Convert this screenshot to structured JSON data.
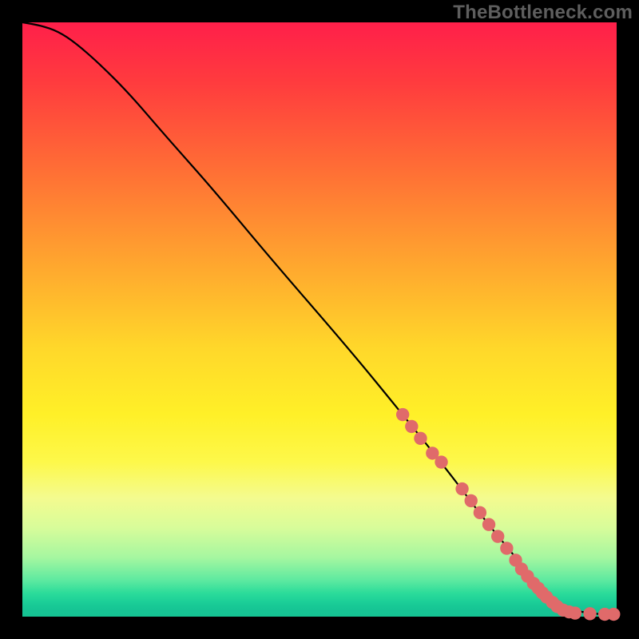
{
  "watermark": "TheBottleneck.com",
  "chart_data": {
    "type": "line",
    "title": "",
    "xlabel": "",
    "ylabel": "",
    "xlim": [
      0,
      100
    ],
    "ylim": [
      0,
      100
    ],
    "gradient_direction": "top-to-bottom",
    "gradient_stops": [
      {
        "pos": 0,
        "hex": "#ff1f4a"
      },
      {
        "pos": 10,
        "hex": "#ff3b3e"
      },
      {
        "pos": 25,
        "hex": "#ff6f35"
      },
      {
        "pos": 42,
        "hex": "#ffab2e"
      },
      {
        "pos": 55,
        "hex": "#ffd82a"
      },
      {
        "pos": 66,
        "hex": "#fff028"
      },
      {
        "pos": 74,
        "hex": "#fdf84a"
      },
      {
        "pos": 80,
        "hex": "#f4fb8f"
      },
      {
        "pos": 85,
        "hex": "#d8fc9a"
      },
      {
        "pos": 90,
        "hex": "#a6f7a0"
      },
      {
        "pos": 94,
        "hex": "#5be9a0"
      },
      {
        "pos": 96,
        "hex": "#2cdc9a"
      },
      {
        "pos": 97.5,
        "hex": "#1ccf98"
      },
      {
        "pos": 98.3,
        "hex": "#17c895"
      },
      {
        "pos": 99,
        "hex": "#16c494"
      },
      {
        "pos": 100,
        "hex": "#15c393"
      }
    ],
    "series": [
      {
        "name": "main-curve",
        "stroke": "#000000",
        "x": [
          0,
          3,
          6,
          9,
          13,
          18,
          24,
          32,
          42,
          55,
          64,
          72,
          78,
          83,
          86,
          88,
          90,
          92,
          94,
          96,
          98,
          100
        ],
        "y": [
          100,
          99.5,
          98.5,
          96.5,
          93,
          88,
          81,
          72,
          60,
          45,
          34,
          24,
          16,
          10,
          6,
          4,
          2.5,
          1.4,
          0.8,
          0.5,
          0.4,
          0.4
        ]
      }
    ],
    "markers": {
      "name": "highlight-dots",
      "color": "#e06a6a",
      "radius_pct": 1.1,
      "points": [
        {
          "x": 64,
          "y": 34
        },
        {
          "x": 65.5,
          "y": 32
        },
        {
          "x": 67,
          "y": 30
        },
        {
          "x": 69,
          "y": 27.5
        },
        {
          "x": 70.5,
          "y": 26
        },
        {
          "x": 74,
          "y": 21.5
        },
        {
          "x": 75.5,
          "y": 19.5
        },
        {
          "x": 77,
          "y": 17.5
        },
        {
          "x": 78.5,
          "y": 15.5
        },
        {
          "x": 80,
          "y": 13.5
        },
        {
          "x": 81.5,
          "y": 11.5
        },
        {
          "x": 83,
          "y": 9.5
        },
        {
          "x": 84,
          "y": 8
        },
        {
          "x": 85,
          "y": 6.8
        },
        {
          "x": 86,
          "y": 5.6
        },
        {
          "x": 86.8,
          "y": 4.8
        },
        {
          "x": 87.5,
          "y": 4
        },
        {
          "x": 88.2,
          "y": 3.3
        },
        {
          "x": 89.2,
          "y": 2.4
        },
        {
          "x": 90,
          "y": 1.7
        },
        {
          "x": 91,
          "y": 1.1
        },
        {
          "x": 92,
          "y": 0.8
        },
        {
          "x": 93,
          "y": 0.6
        },
        {
          "x": 95.5,
          "y": 0.5
        },
        {
          "x": 98,
          "y": 0.4
        },
        {
          "x": 99.5,
          "y": 0.4
        }
      ]
    }
  }
}
